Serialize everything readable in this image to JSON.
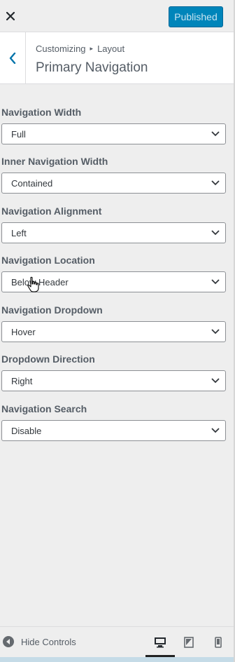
{
  "header": {
    "close_icon": "close-icon",
    "publish_label": "Published",
    "publish_color": "#0085ba"
  },
  "section": {
    "breadcrumb_root": "Customizing",
    "breadcrumb_current": "Layout",
    "title": "Primary Navigation"
  },
  "controls": [
    {
      "label": "Navigation Width",
      "value": "Full"
    },
    {
      "label": "Inner Navigation Width",
      "value": "Contained"
    },
    {
      "label": "Navigation Alignment",
      "value": "Left"
    },
    {
      "label": "Navigation Location",
      "value": "Below Header"
    },
    {
      "label": "Navigation Dropdown",
      "value": "Hover"
    },
    {
      "label": "Dropdown Direction",
      "value": "Right"
    },
    {
      "label": "Navigation Search",
      "value": "Disable"
    }
  ],
  "footer": {
    "hide_controls_label": "Hide Controls",
    "devices": [
      "desktop-icon",
      "tablet-icon",
      "mobile-icon"
    ],
    "active_device": "desktop"
  }
}
